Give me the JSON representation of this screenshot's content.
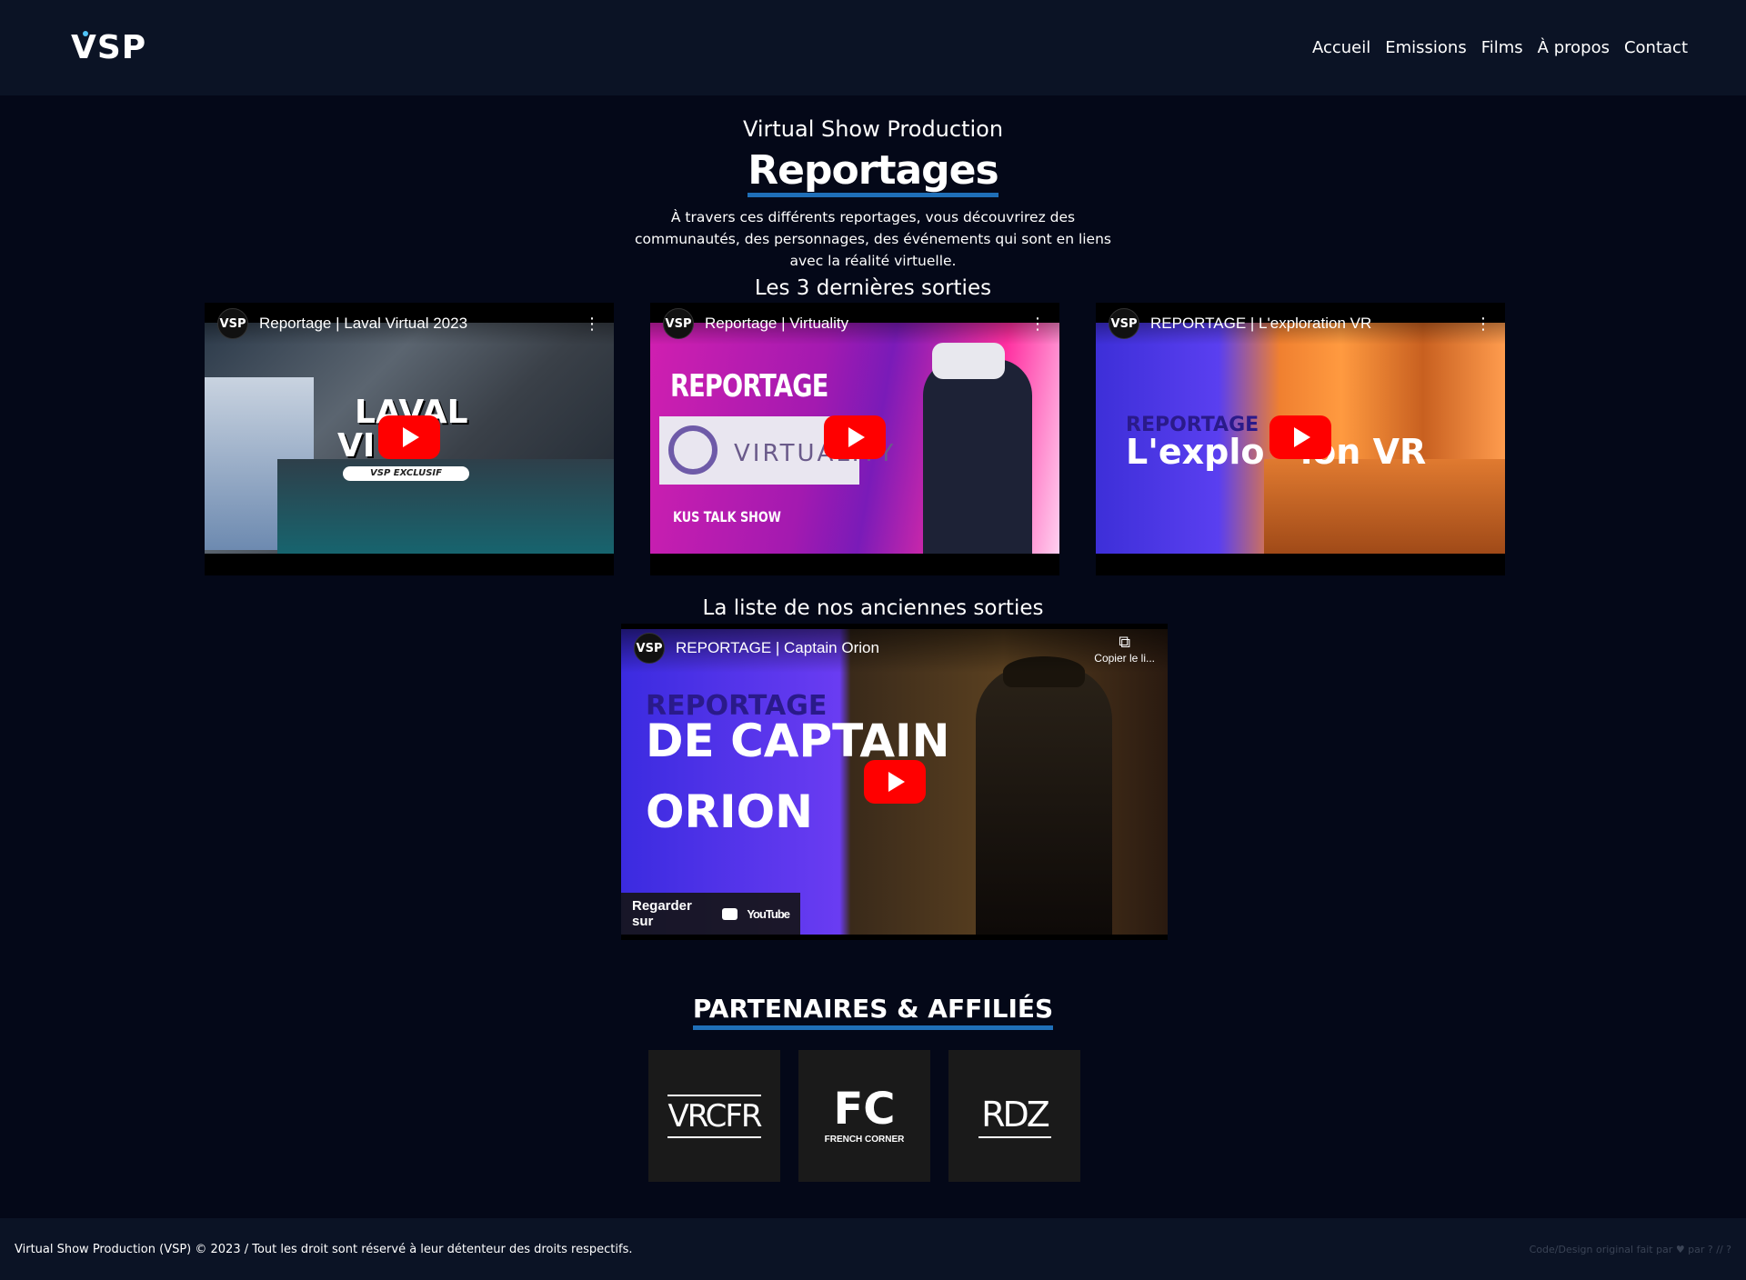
{
  "brand": {
    "logo_text": "VSP"
  },
  "nav": {
    "items": [
      "Accueil",
      "Emissions",
      "Films",
      "À propos",
      "Contact"
    ]
  },
  "hero": {
    "subtitle": "Virtual Show Production",
    "title": "Reportages",
    "description": "À travers ces différents reportages, vous découvrirez des communautés, des personnages, des événements qui sont en liens avec la réalité virtuelle."
  },
  "latest": {
    "heading": "Les 3 dernières sorties",
    "videos": [
      {
        "channel": "VSP",
        "title": "Reportage | Laval Virtual 2023",
        "overlay_line1": "LAVAL",
        "overlay_line2": "VI AL",
        "overlay_tag": "VSP EXCLUSIF"
      },
      {
        "channel": "VSP",
        "title": "Reportage | Virtuality",
        "overlay_line1": "REPORTAGE",
        "overlay_line2": "VIRTUALITY",
        "overlay_tag": "KUS TALK SHOW"
      },
      {
        "channel": "VSP",
        "title": "REPORTAGE | L'exploration VR",
        "overlay_line1": "REPORTAGE",
        "overlay_line2": "L'explo   ion VR"
      }
    ]
  },
  "older": {
    "heading": "La liste de nos anciennes sorties",
    "video": {
      "channel": "VSP",
      "title": "REPORTAGE | Captain Orion",
      "copy_label": "Copier le li...",
      "watch_label": "Regarder sur",
      "youtube_label": "YouTube",
      "overlay_line1": "REPORTAGE",
      "overlay_line2": "DE CAPTAIN",
      "overlay_line3": "ORION"
    }
  },
  "partners": {
    "heading": "PARTENAIRES & AFFILIÉS",
    "items": [
      {
        "name": "VRCFR",
        "caption": ""
      },
      {
        "name": "FC",
        "caption": "FRENCH CORNER"
      },
      {
        "name": "RDZ",
        "caption": ""
      }
    ]
  },
  "footer": {
    "left": "Virtual Show Production (VSP) © 2023 / Tout les droit sont réservé à leur détenteur des droits respectifs.",
    "right": "Code/Design original fait par ♥ par ? // ?"
  },
  "colors": {
    "background": "#040818",
    "header": "#0b1325",
    "accent": "#1f6fb8",
    "play": "#ff0000"
  }
}
